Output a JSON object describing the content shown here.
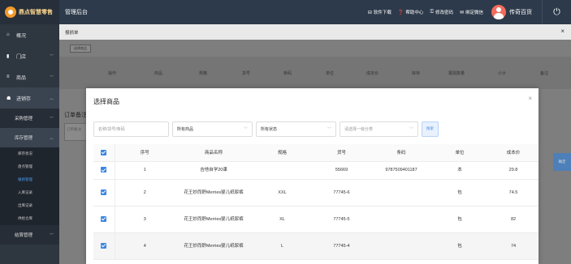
{
  "header": {
    "logo_text": "鼎点智慧零售",
    "system_title": "管理后台",
    "links": [
      {
        "icon": "⊟",
        "label": "软件下载"
      },
      {
        "icon": "❓",
        "label": "帮助中心"
      },
      {
        "icon": "⚿",
        "label": "修改密码"
      },
      {
        "icon": "✉",
        "label": "绑定微信"
      }
    ],
    "username": "传奇百货",
    "power_icon": "⏻"
  },
  "sidebar": {
    "items": [
      {
        "icon": "⌂",
        "label": "概况"
      },
      {
        "icon": "▮",
        "label": "门店"
      },
      {
        "icon": "≡",
        "label": "商品"
      },
      {
        "icon": "☗",
        "label": "进销存"
      }
    ],
    "purchase_label": "采购管理",
    "stock_label": "库存管理",
    "leaves": [
      "库存状况",
      "盘点管理",
      "报损管理",
      "入库记录",
      "出库记录",
      "供给仓库"
    ],
    "settlement_label": "结算管理"
  },
  "panel": {
    "title": "报损单",
    "close": "×",
    "select_btn": "选择商品",
    "columns": [
      "操作",
      "商品",
      "规格",
      "货号",
      "条码",
      "单位",
      "成本价",
      "库存",
      "报损数量",
      "小计",
      "备注"
    ],
    "order_remark": "订单备注",
    "remark_placeholder": "订单备注",
    "confirm": "确定"
  },
  "modal": {
    "title": "选择商品",
    "close": "×",
    "search_placeholder": "名称/货号/条码",
    "filter_products": "所有商品",
    "filter_status": "所有状态",
    "category_placeholder": "请选择一级分类",
    "search_btn": "搜索",
    "columns": [
      "序号",
      "商品名称",
      "规格",
      "货号",
      "条码",
      "单位",
      "成本价"
    ],
    "rows": [
      {
        "no": "1",
        "name": "吉他自学20课",
        "spec": "",
        "code": "55669",
        "barcode": "9787509401187",
        "unit": "本",
        "cost": "29.8"
      },
      {
        "no": "2",
        "name": "花王妙而舒Merries婴儿纸尿裤",
        "spec": "XXL",
        "code": "77745-6",
        "barcode": "",
        "unit": "包",
        "cost": "74.5"
      },
      {
        "no": "3",
        "name": "花王妙而舒Merries婴儿纸尿裤",
        "spec": "XL",
        "code": "77745-5",
        "barcode": "",
        "unit": "包",
        "cost": "82"
      },
      {
        "no": "4",
        "name": "花王妙而舒Merries婴儿纸尿裤",
        "spec": "L",
        "code": "77745-4",
        "barcode": "",
        "unit": "包",
        "cost": "74"
      }
    ]
  }
}
